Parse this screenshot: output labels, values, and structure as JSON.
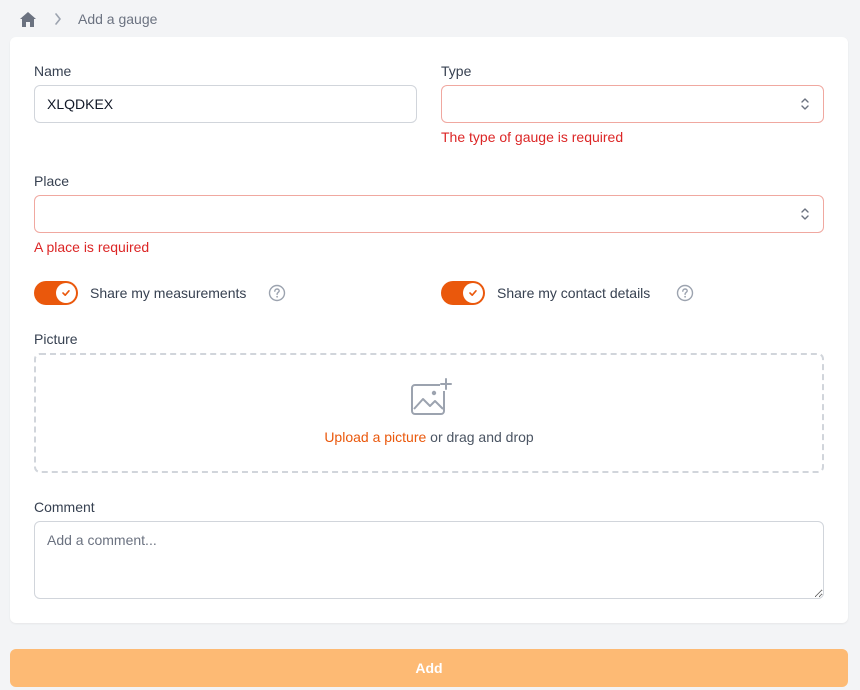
{
  "breadcrumb": {
    "home_icon": "home-icon",
    "separator_icon": "chevron-right-icon",
    "current": "Add a gauge"
  },
  "form": {
    "name": {
      "label": "Name",
      "value": "XLQDKEX"
    },
    "type": {
      "label": "Type",
      "value": "",
      "error": "The type of gauge is required"
    },
    "place": {
      "label": "Place",
      "value": "",
      "error": "A place is required"
    },
    "share_measurements": {
      "label": "Share my measurements",
      "checked": true,
      "help_icon": "question-circle-icon"
    },
    "share_contact": {
      "label": "Share my contact details",
      "checked": true,
      "help_icon": "question-circle-icon"
    },
    "picture": {
      "label": "Picture",
      "icon": "image-add-icon",
      "upload_link": "Upload a picture",
      "drag_text": " or drag and drop"
    },
    "comment": {
      "label": "Comment",
      "placeholder": "Add a comment..."
    }
  },
  "actions": {
    "add_label": "Add"
  },
  "colors": {
    "accent": "#ea580c",
    "error": "#dc2626",
    "error_border": "#f0a8a0",
    "button_disabled": "#fdba74"
  }
}
